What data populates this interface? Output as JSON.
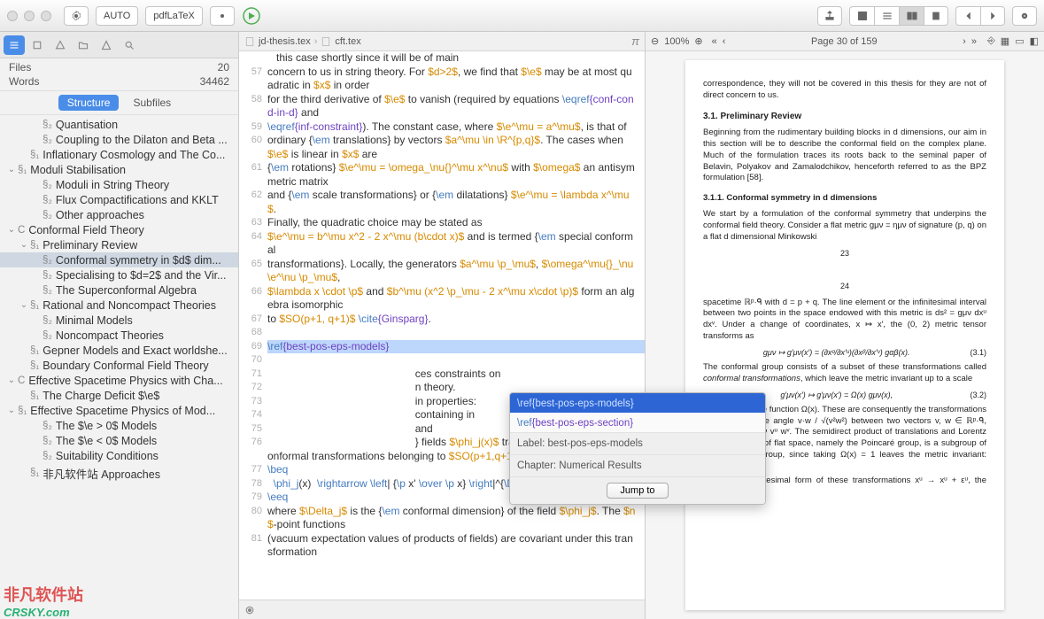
{
  "titlebar": {
    "auto_label": "AUTO",
    "engine_label": "pdfLaTeX"
  },
  "sidebar": {
    "files_label": "Files",
    "files_count": "20",
    "words_label": "Words",
    "words_count": "34462",
    "tabs": {
      "structure": "Structure",
      "subfiles": "Subfiles"
    },
    "items": [
      {
        "indent": 2,
        "chev": "",
        "sec": "§₂",
        "text": "Quantisation"
      },
      {
        "indent": 2,
        "chev": "",
        "sec": "§₂",
        "text": "Coupling to the Dilaton and Beta ..."
      },
      {
        "indent": 1,
        "chev": "",
        "sec": "§₁",
        "text": "Inflationary Cosmology and The Co..."
      },
      {
        "indent": 0,
        "chev": "⌄",
        "sec": "§₁",
        "text": "Moduli Stabilisation"
      },
      {
        "indent": 2,
        "chev": "",
        "sec": "§₂",
        "text": "Moduli in String Theory"
      },
      {
        "indent": 2,
        "chev": "",
        "sec": "§₂",
        "text": "Flux Compactifications and KKLT"
      },
      {
        "indent": 2,
        "chev": "",
        "sec": "§₂",
        "text": "Other approaches"
      },
      {
        "indent": 0,
        "chev": "⌄",
        "sec": "C",
        "text": "Conformal Field Theory"
      },
      {
        "indent": 1,
        "chev": "⌄",
        "sec": "§₁",
        "text": "Preliminary Review"
      },
      {
        "indent": 2,
        "chev": "",
        "sec": "§₂",
        "text": "Conformal symmetry in $d$ dim...",
        "active": true
      },
      {
        "indent": 2,
        "chev": "",
        "sec": "§₂",
        "text": "Specialising to $d=2$ and the Vir..."
      },
      {
        "indent": 2,
        "chev": "",
        "sec": "§₂",
        "text": "The Superconformal Algebra"
      },
      {
        "indent": 1,
        "chev": "⌄",
        "sec": "§₁",
        "text": "Rational and Noncompact Theories"
      },
      {
        "indent": 2,
        "chev": "",
        "sec": "§₂",
        "text": "Minimal Models"
      },
      {
        "indent": 2,
        "chev": "",
        "sec": "§₂",
        "text": "Noncompact Theories"
      },
      {
        "indent": 1,
        "chev": "",
        "sec": "§₁",
        "text": "Gepner Models and Exact worldshe..."
      },
      {
        "indent": 1,
        "chev": "",
        "sec": "§₁",
        "text": "Boundary Conformal Field Theory"
      },
      {
        "indent": 0,
        "chev": "⌄",
        "sec": "C",
        "text": "Effective Spacetime Physics with Cha..."
      },
      {
        "indent": 1,
        "chev": "",
        "sec": "§₁",
        "text": "The Charge Deficit $\\e$"
      },
      {
        "indent": 0,
        "chev": "⌄",
        "sec": "§₁",
        "text": "Effective Spacetime Physics of Mod..."
      },
      {
        "indent": 2,
        "chev": "",
        "sec": "§₂",
        "text": "The $\\e > 0$ Models"
      },
      {
        "indent": 2,
        "chev": "",
        "sec": "§₂",
        "text": "The $\\e < 0$ Models"
      },
      {
        "indent": 2,
        "chev": "",
        "sec": "§₂",
        "text": "Suitability Conditions"
      },
      {
        "indent": 1,
        "chev": "",
        "sec": "§₁",
        "text": "非凡软件站 Approaches"
      }
    ]
  },
  "editor": {
    "crumb1": "jd-thesis.tex",
    "crumb2": "cft.tex",
    "lines": [
      {
        "n": "",
        "html": "&nbsp;&nbsp;&nbsp;this case shortly since it will be of main"
      },
      {
        "n": "57",
        "html": "concern to us in string theory. For <span class='tok-math'>$d>2$</span>, we find that <span class='tok-math'>$\\e$</span> may be at most quadratic in <span class='tok-math'>$x$</span> in order"
      },
      {
        "n": "58",
        "html": "for the third derivative of <span class='tok-math'>$\\e$</span> to vanish (required by equations <span class='tok-cmd'>\\eqref</span><span class='tok-brace'>{conf-cond-in-d}</span> and"
      },
      {
        "n": "59",
        "html": "<span class='tok-cmd'>\\eqref</span><span class='tok-brace'>{inf-constraint}</span>). The constant case, where <span class='tok-math'>$\\e^\\mu = a^\\mu$</span>, is that of"
      },
      {
        "n": "60",
        "html": "ordinary {<span class='tok-cmd'>\\em</span> translations} by vectors <span class='tok-math'>$a^\\mu \\in \\R^{p,q}$</span>. The cases when <span class='tok-math'>$\\e$</span> is linear in <span class='tok-math'>$x$</span> are"
      },
      {
        "n": "61",
        "html": "{<span class='tok-cmd'>\\em</span> rotations} <span class='tok-math'>$\\e^\\mu = \\omega_\\nu{}^\\mu x^\\nu$</span> with <span class='tok-math'>$\\omega$</span> an antisymmetric matrix"
      },
      {
        "n": "62",
        "html": "and {<span class='tok-cmd'>\\em</span> scale transformations} or {<span class='tok-cmd'>\\em</span> dilatations} <span class='tok-math'>$\\e^\\mu = \\lambda x^\\mu$</span>."
      },
      {
        "n": "63",
        "html": "Finally, the quadratic choice may be stated as"
      },
      {
        "n": "64",
        "html": "<span class='tok-math'>$\\e^\\mu = b^\\mu x^2 - 2 x^\\mu (b\\cdot x)$</span> and is termed {<span class='tok-cmd'>\\em</span> special conformal"
      },
      {
        "n": "65",
        "html": "transformations}. Locally, the generators <span class='tok-math'>$a^\\mu \\p_\\mu$</span>, <span class='tok-math'>$\\omega^\\mu{}_\\nu \\e^\\nu \\p_\\mu$</span>,"
      },
      {
        "n": "66",
        "html": "<span class='tok-math'>$\\lambda x \\cdot \\p$</span> and <span class='tok-math'>$b^\\mu (x^2 \\p_\\mu - 2 x^\\mu x\\cdot \\p)$</span> form an algebra isomorphic"
      },
      {
        "n": "67",
        "html": "to <span class='tok-math'>$SO(p+1, q+1)$</span> <span class='tok-cmd'>\\cite</span><span class='tok-brace'>{Ginsparg}</span>."
      },
      {
        "n": "68",
        "html": ""
      },
      {
        "n": "69",
        "html": "<span class='tok-cmd'>\\ref</span><span class='tok-brace'>{best-pos-eps-models}</span>",
        "hl": true
      },
      {
        "n": "70",
        "html": ""
      },
      {
        "n": "71",
        "html": "&nbsp;&nbsp;&nbsp;&nbsp;&nbsp;&nbsp;&nbsp;&nbsp;&nbsp;&nbsp;&nbsp;&nbsp;&nbsp;&nbsp;&nbsp;&nbsp;&nbsp;&nbsp;&nbsp;&nbsp;&nbsp;&nbsp;&nbsp;&nbsp;&nbsp;&nbsp;&nbsp;&nbsp;&nbsp;&nbsp;&nbsp;&nbsp;&nbsp;&nbsp;&nbsp;&nbsp;&nbsp;&nbsp;&nbsp;&nbsp;&nbsp;&nbsp;&nbsp;&nbsp;&nbsp;&nbsp;&nbsp;&nbsp;&nbsp;&nbsp;ces constraints on"
      },
      {
        "n": "72",
        "html": "&nbsp;&nbsp;&nbsp;&nbsp;&nbsp;&nbsp;&nbsp;&nbsp;&nbsp;&nbsp;&nbsp;&nbsp;&nbsp;&nbsp;&nbsp;&nbsp;&nbsp;&nbsp;&nbsp;&nbsp;&nbsp;&nbsp;&nbsp;&nbsp;&nbsp;&nbsp;&nbsp;&nbsp;&nbsp;&nbsp;&nbsp;&nbsp;&nbsp;&nbsp;&nbsp;&nbsp;&nbsp;&nbsp;&nbsp;&nbsp;&nbsp;&nbsp;&nbsp;&nbsp;&nbsp;&nbsp;&nbsp;&nbsp;&nbsp;&nbsp;n theory."
      },
      {
        "n": "73",
        "html": "&nbsp;&nbsp;&nbsp;&nbsp;&nbsp;&nbsp;&nbsp;&nbsp;&nbsp;&nbsp;&nbsp;&nbsp;&nbsp;&nbsp;&nbsp;&nbsp;&nbsp;&nbsp;&nbsp;&nbsp;&nbsp;&nbsp;&nbsp;&nbsp;&nbsp;&nbsp;&nbsp;&nbsp;&nbsp;&nbsp;&nbsp;&nbsp;&nbsp;&nbsp;&nbsp;&nbsp;&nbsp;&nbsp;&nbsp;&nbsp;&nbsp;&nbsp;&nbsp;&nbsp;&nbsp;&nbsp;&nbsp;&nbsp;&nbsp;&nbsp;in properties:"
      },
      {
        "n": "74",
        "html": "&nbsp;&nbsp;&nbsp;&nbsp;&nbsp;&nbsp;&nbsp;&nbsp;&nbsp;&nbsp;&nbsp;&nbsp;&nbsp;&nbsp;&nbsp;&nbsp;&nbsp;&nbsp;&nbsp;&nbsp;&nbsp;&nbsp;&nbsp;&nbsp;&nbsp;&nbsp;&nbsp;&nbsp;&nbsp;&nbsp;&nbsp;&nbsp;&nbsp;&nbsp;&nbsp;&nbsp;&nbsp;&nbsp;&nbsp;&nbsp;&nbsp;&nbsp;&nbsp;&nbsp;&nbsp;&nbsp;&nbsp;&nbsp;&nbsp;&nbsp;containing in"
      },
      {
        "n": "75",
        "html": "&nbsp;&nbsp;&nbsp;&nbsp;&nbsp;&nbsp;&nbsp;&nbsp;&nbsp;&nbsp;&nbsp;&nbsp;&nbsp;&nbsp;&nbsp;&nbsp;&nbsp;&nbsp;&nbsp;&nbsp;&nbsp;&nbsp;&nbsp;&nbsp;&nbsp;&nbsp;&nbsp;&nbsp;&nbsp;&nbsp;&nbsp;&nbsp;&nbsp;&nbsp;&nbsp;&nbsp;&nbsp;&nbsp;&nbsp;&nbsp;&nbsp;&nbsp;&nbsp;&nbsp;&nbsp;&nbsp;&nbsp;&nbsp;&nbsp;&nbsp;and"
      },
      {
        "n": "76",
        "html": "&nbsp;&nbsp;&nbsp;&nbsp;&nbsp;&nbsp;&nbsp;&nbsp;&nbsp;&nbsp;&nbsp;&nbsp;&nbsp;&nbsp;&nbsp;&nbsp;&nbsp;&nbsp;&nbsp;&nbsp;&nbsp;&nbsp;&nbsp;&nbsp;&nbsp;&nbsp;&nbsp;&nbsp;&nbsp;&nbsp;&nbsp;&nbsp;&nbsp;&nbsp;&nbsp;&nbsp;&nbsp;&nbsp;&nbsp;&nbsp;&nbsp;&nbsp;&nbsp;&nbsp;&nbsp;&nbsp;&nbsp;&nbsp;&nbsp;&nbsp;} fields <span class='tok-math'>$\\phi_j(x)$</span> transform under the global conformal transformations belonging to <span class='tok-math'>$SO(p+1,q+1)$</span> as follows"
      },
      {
        "n": "77",
        "html": "<span class='tok-cmd'>\\beq</span>"
      },
      {
        "n": "78",
        "html": "&nbsp;&nbsp;<span class='tok-cmd'>\\phi_j</span>(x)&nbsp;&nbsp;<span class='tok-cmd'>\\rightarrow \\left</span>| {<span class='tok-cmd'>\\p</span> x' <span class='tok-cmd'>\\over \\p</span> x} <span class='tok-cmd'>\\right</span>|^{<span class='tok-cmd'>\\Delta_j</span>/d} <span class='tok-cmd'>\\phi_j</span>(x'),"
      },
      {
        "n": "79",
        "html": "<span class='tok-cmd'>\\eeq</span>"
      },
      {
        "n": "80",
        "html": "where <span class='tok-math'>$\\Delta_j$</span> is the {<span class='tok-cmd'>\\em</span> conformal dimension} of the field <span class='tok-math'>$\\phi_j$</span>. The <span class='tok-math'>$n$</span>-point functions"
      },
      {
        "n": "81",
        "html": "(vacuum expectation values of products of fields) are covariant under this transformation"
      }
    ],
    "popup": {
      "opt1": "\\ref{best-pos-eps-models}",
      "opt2": "\\ref{best-pos-eps-section}",
      "label_line": "Label: best-pos-eps-models",
      "chapter_line": "Chapter: Numerical Results",
      "jump_label": "Jump to"
    }
  },
  "preview": {
    "zoom": "100%",
    "page_label": "Page 30 of 159",
    "pdf": {
      "lead": "correspondence, they will not be covered in this thesis for they are not of direct concern to us.",
      "h31": "3.1.  Preliminary Review",
      "p1": "Beginning from the rudimentary building blocks in d dimensions, our aim in this section will be to describe the conformal field on the complex plane. Much of the formulation traces its roots back to the seminal paper of Belavin, Polyakov and Zamalodchikov, henceforth referred to as the BPZ formulation [58].",
      "h311": "3.1.1.  Conformal symmetry in d dimensions",
      "p2": "We start by a formulation of the conformal symmetry that underpins the conformal field theory. Consider a flat metric gμν = ημν of signature (p, q) on a flat d dimensional Minkowski",
      "pn1": "23",
      "pn2": "24",
      "p3": "spacetime ℝᵖ·ᑫ with d = p + q. The line element or the infinitesimal interval between two points in the space endowed with this metric is ds² = gμν dxᵘ dxᵛ. Under a change of coordinates, x ↦ x′, the (0, 2) metric tensor transforms as",
      "eq1": "gμν ↦ g′μν(x′) = (∂xᵅ/∂x′ᵘ)(∂xᵝ/∂x′ᵛ) gαβ(x).",
      "eq1n": "(3.1)",
      "p4": "The conformal group consists of a subset of these transformations called conformal transformations, which leave the metric invariant up to a scale",
      "eq2": "g′μν(x′) ↦ g′μν(x′) = Ω(x) gμν(x),",
      "eq2n": "(3.2)",
      "p5": "for some positive function Ω(x). These are consequently the transformations that preserve the angle v·w / √(v²w²) between two vectors v, w ∈ ℝᵖ·ᑫ, where v·w = gμν vᵘ wᵛ. The semidirect product of translations and Lorentz transformations of flat space, namely the Poincaré group, is a subgroup of the conformal group, since taking Ω(x) = 1 leaves the metric invariant: g′μν(x′) = gμν(x).",
      "p6": "Under the infinitesimal form of these transformations xᵘ → xᵘ + εᵘ, the metric in the flat"
    }
  },
  "watermark": {
    "line1": "非凡软件站",
    "line2": "CRSKY.com"
  }
}
